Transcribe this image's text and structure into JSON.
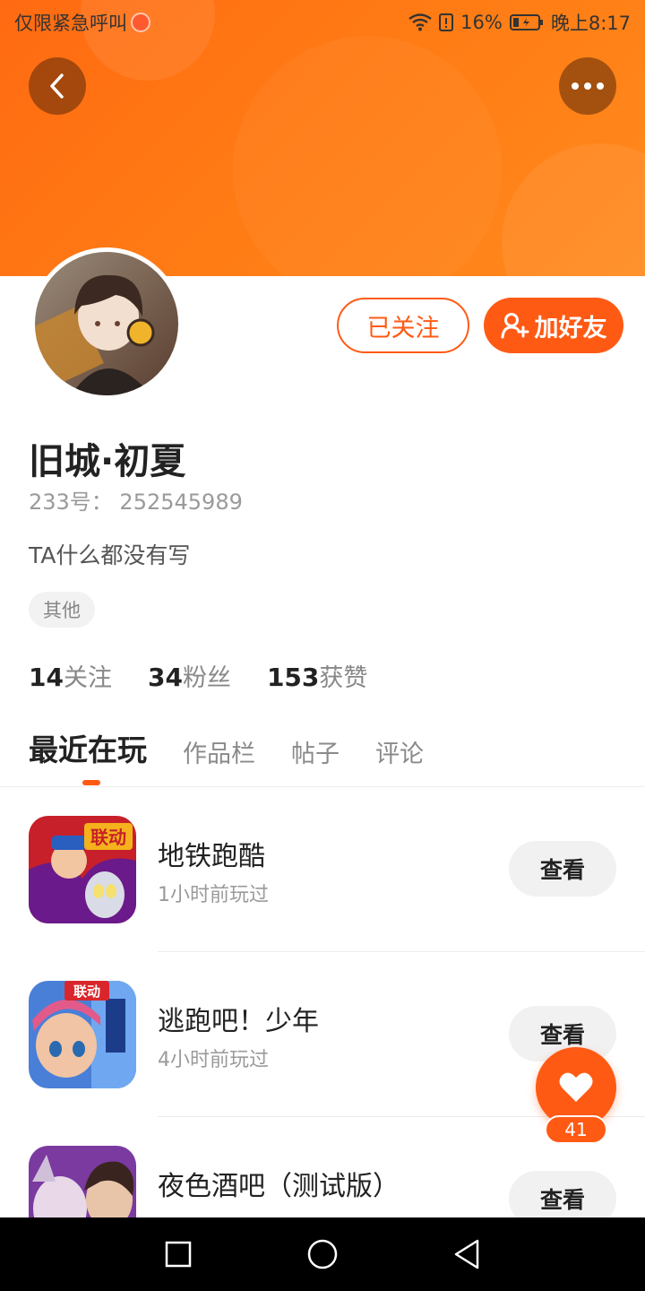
{
  "status_bar": {
    "carrier": "仅限紧急呼叫",
    "battery_percent": "16%",
    "time": "晚上8:17"
  },
  "header": {
    "back_icon": "chevron-left-icon",
    "more_icon": "more-dots-icon"
  },
  "profile": {
    "follow_button": "已关注",
    "add_friend_button": "加好友",
    "username": "旧城·初夏",
    "user_id": "233号：  252545989",
    "bio": "TA什么都没有写",
    "tag": "其他"
  },
  "stats": [
    {
      "num": "14",
      "label": "关注"
    },
    {
      "num": "34",
      "label": "粉丝"
    },
    {
      "num": "153",
      "label": "获赞"
    }
  ],
  "tabs": [
    {
      "label": "最近在玩",
      "active": true
    },
    {
      "label": "作品栏",
      "active": false
    },
    {
      "label": "帖子",
      "active": false
    },
    {
      "label": "评论",
      "active": false
    }
  ],
  "games": [
    {
      "name": "地铁跑酷",
      "time": "1小时前玩过",
      "button": "查看",
      "badge": "联动"
    },
    {
      "name": "逃跑吧！少年",
      "time": "4小时前玩过",
      "button": "查看",
      "badge": "联动"
    },
    {
      "name": "夜色酒吧（测试版）",
      "time": "",
      "button": "查看"
    }
  ],
  "like": {
    "count": "41"
  },
  "colors": {
    "accent": "#ff5a14",
    "banner": "#ff7a14"
  }
}
